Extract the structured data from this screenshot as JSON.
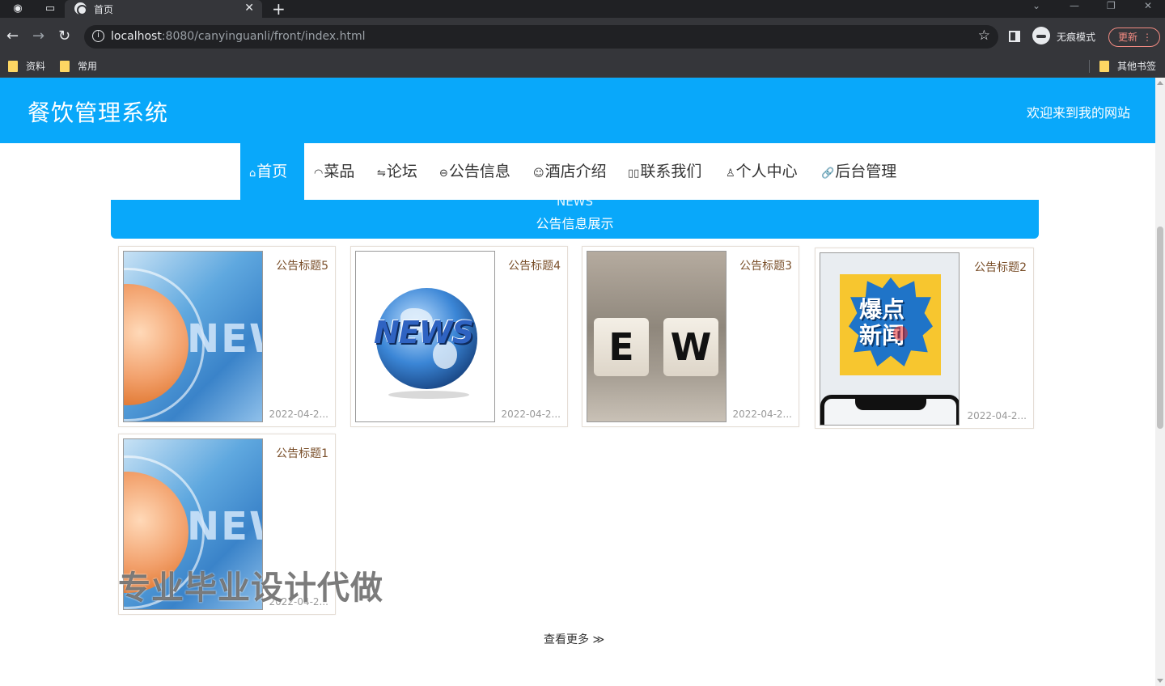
{
  "browser": {
    "tab_title": "首页",
    "url_host": "localhost",
    "url_rest": ":8080/canyinguanli/front/index.html",
    "incognito_label": "无痕模式",
    "update_label": "更新",
    "bookmarks": [
      "资料",
      "常用"
    ],
    "other_bookmarks": "其他书签"
  },
  "site": {
    "title": "餐饮管理系统",
    "welcome": "欢迎来到我的网站"
  },
  "nav": [
    {
      "icon": "⌂",
      "label": "首页"
    },
    {
      "icon": "◠",
      "label": "菜品"
    },
    {
      "icon": "⇋",
      "label": "论坛"
    },
    {
      "icon": "⊖",
      "label": "公告信息"
    },
    {
      "icon": "☺",
      "label": "酒店介绍"
    },
    {
      "icon": "▯▯",
      "label": "联系我们"
    },
    {
      "icon": "♙",
      "label": "个人中心"
    },
    {
      "icon": "🔗",
      "label": "后台管理"
    }
  ],
  "section": {
    "en": "NEWS",
    "zh": "公告信息展示"
  },
  "notices": [
    {
      "title": "公告标题5",
      "date": "2022-04-2..."
    },
    {
      "title": "公告标题4",
      "date": "2022-04-2..."
    },
    {
      "title": "公告标题3",
      "date": "2022-04-2..."
    },
    {
      "title": "公告标题2",
      "date": "2022-04-2..."
    },
    {
      "title": "公告标题1",
      "date": "2022-04-2..."
    }
  ],
  "images": {
    "news_word": "NEW",
    "globe_word": "NEWS",
    "dice": [
      "E",
      "W"
    ],
    "badge_lines": [
      "爆点",
      "新闻"
    ]
  },
  "more_label": "查看更多 ≫",
  "watermark": "专业毕业设计代做",
  "colors": {
    "brand": "#09a8fa"
  }
}
